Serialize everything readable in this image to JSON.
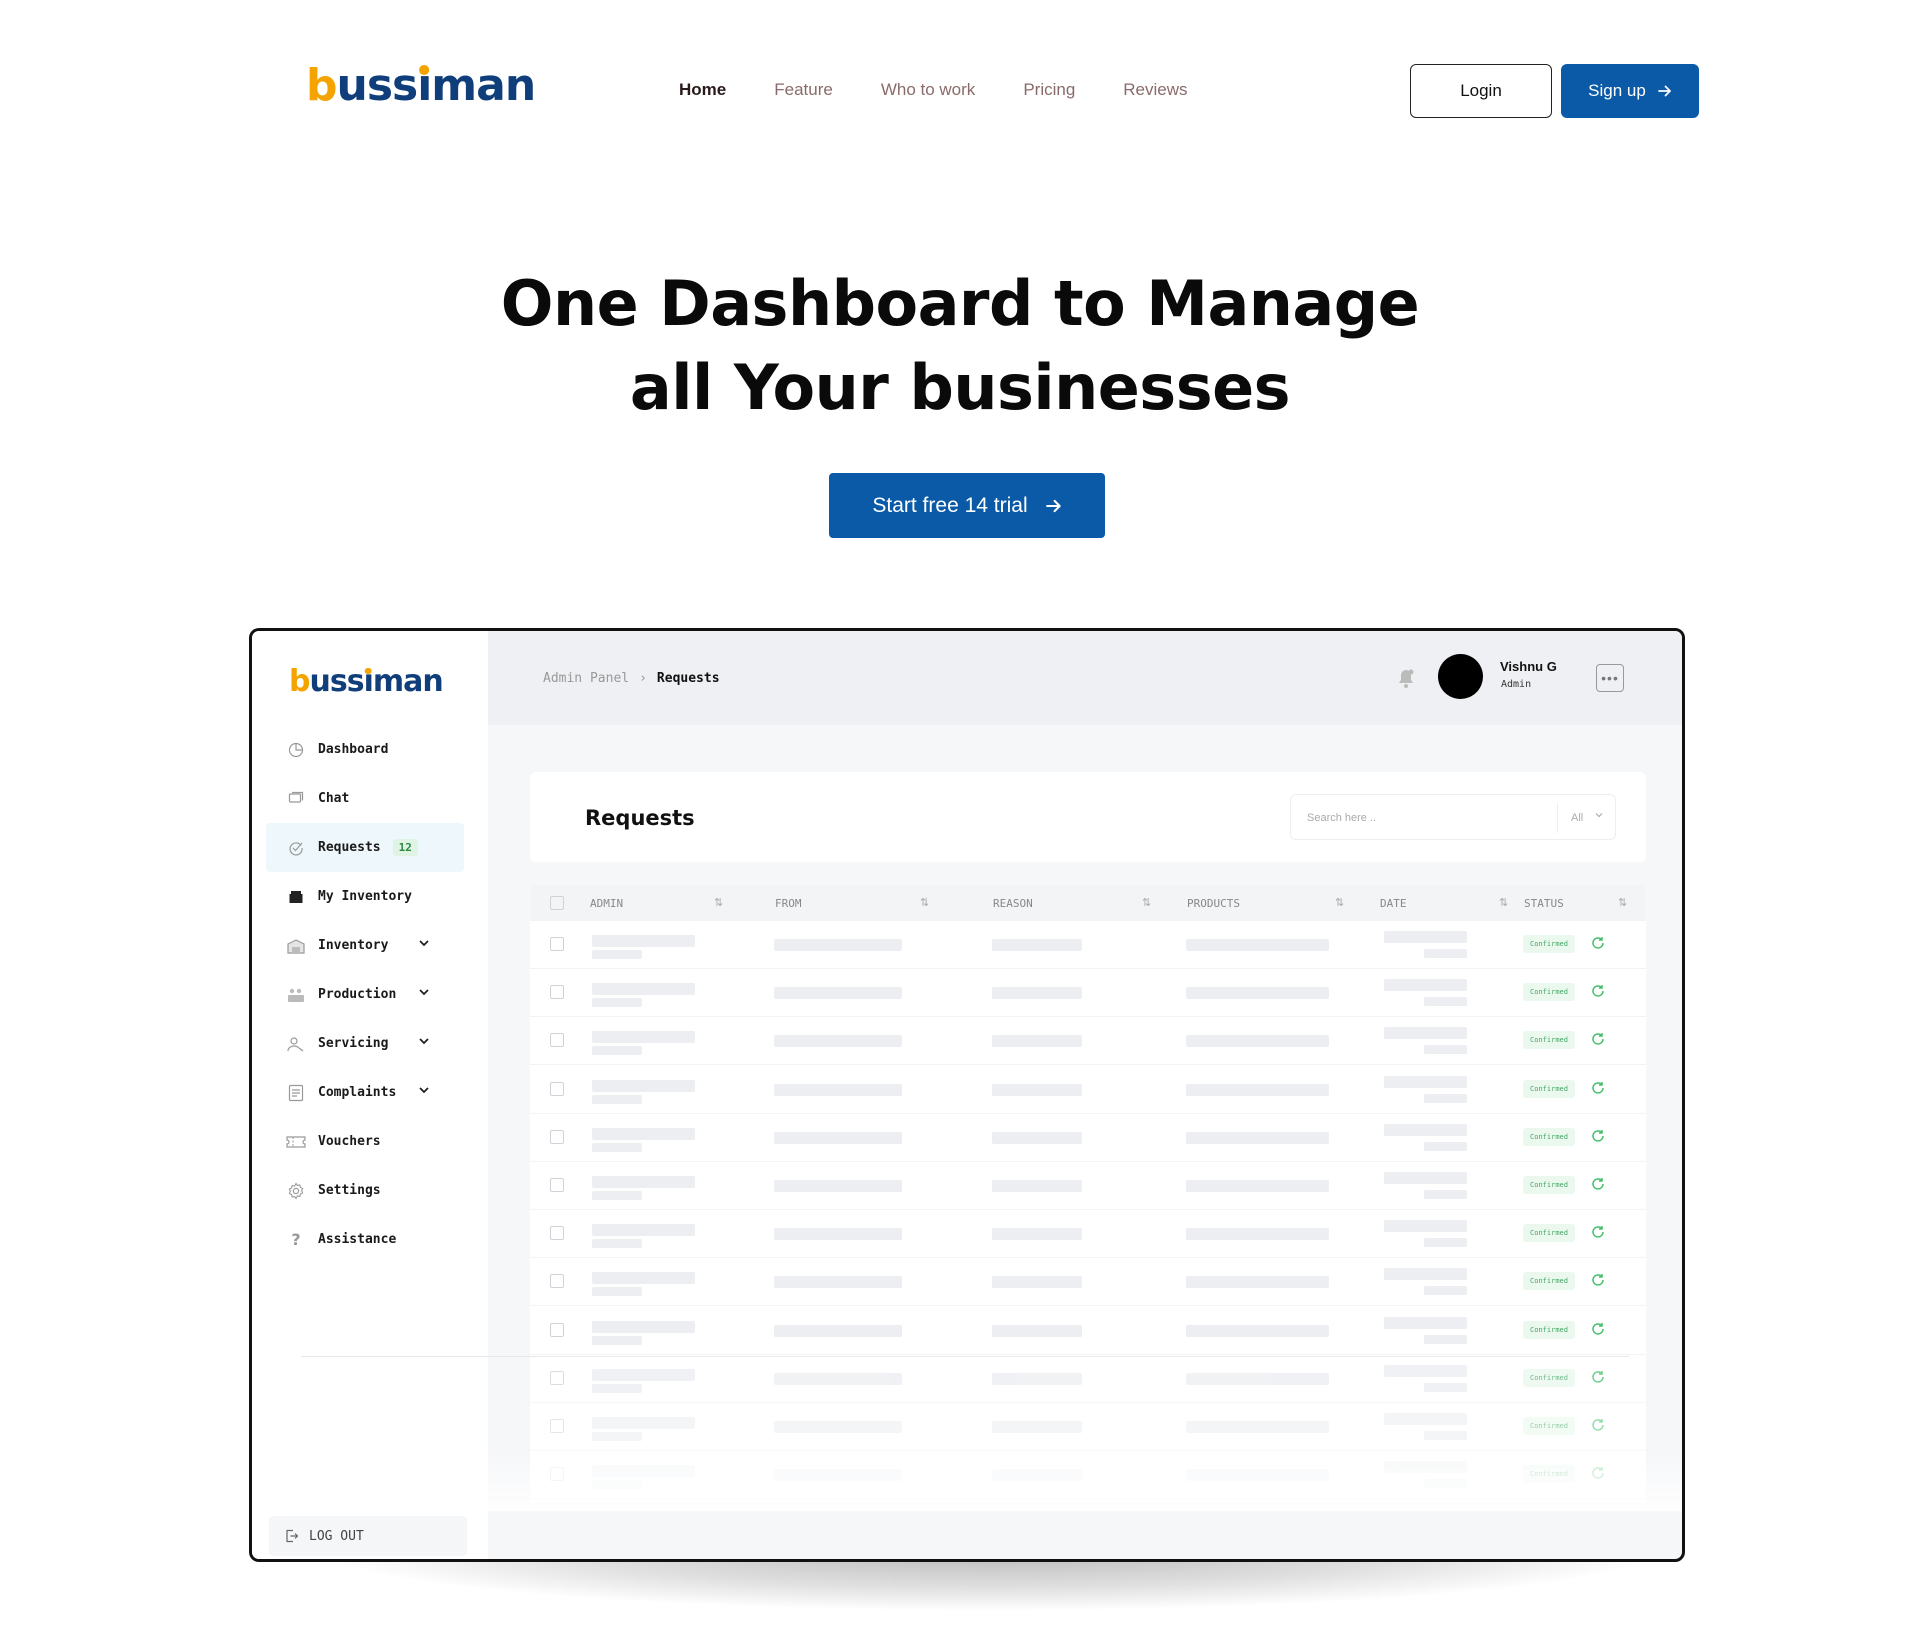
{
  "brand": {
    "b": "b",
    "name_mid": "uss",
    "i": "ı",
    "name_end": "man"
  },
  "nav": {
    "items": [
      {
        "label": "Home",
        "active": true
      },
      {
        "label": "Feature",
        "active": false
      },
      {
        "label": "Who to work",
        "active": false
      },
      {
        "label": "Pricing",
        "active": false
      },
      {
        "label": "Reviews",
        "active": false
      }
    ],
    "login_label": "Login",
    "signup_label": "Sign up"
  },
  "hero": {
    "title_line1": "One Dashboard to Manage",
    "title_line2": "all Your businesses",
    "cta_label": "Start free 14 trial"
  },
  "dashboard": {
    "sidebar": {
      "items": [
        {
          "label": "Dashboard",
          "icon": "pie-chart-icon"
        },
        {
          "label": "Chat",
          "icon": "chat-icon"
        },
        {
          "label": "Requests",
          "icon": "check-circle-icon",
          "badge": "12",
          "active": true
        },
        {
          "label": "My Inventory",
          "icon": "box-icon"
        },
        {
          "label": "Inventory",
          "icon": "warehouse-icon",
          "expandable": true
        },
        {
          "label": "Production",
          "icon": "factory-icon",
          "expandable": true
        },
        {
          "label": "Servicing",
          "icon": "user-wrench-icon",
          "expandable": true
        },
        {
          "label": "Complaints",
          "icon": "document-icon",
          "expandable": true
        },
        {
          "label": "Vouchers",
          "icon": "ticket-icon"
        },
        {
          "label": "Settings",
          "icon": "gear-icon"
        },
        {
          "label": "Assistance",
          "icon": "question-icon"
        }
      ],
      "logout_label": "LOG OUT"
    },
    "topbar": {
      "breadcrumb_parent": "Admin Panel",
      "breadcrumb_current": "Requests",
      "user_name": "Vishnu G",
      "user_role": "Admin"
    },
    "requests": {
      "title": "Requests",
      "search_placeholder": "Search here ..",
      "filter_value": "All",
      "columns": [
        "ADMIN",
        "FROM",
        "REASON",
        "PRODUCTS",
        "DATE",
        "STATUS"
      ],
      "status_label": "Confirmed",
      "row_count": 12
    }
  },
  "colors": {
    "primary": "#0b5aa8",
    "brand_orange": "#f5a300",
    "brand_navy": "#0f3e7a",
    "status_green": "#43a866"
  }
}
